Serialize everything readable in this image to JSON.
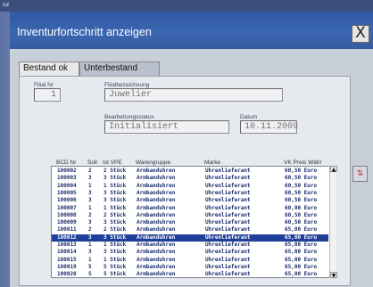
{
  "topbar": {
    "label": "sz"
  },
  "window": {
    "title": "Inventurfortschritt anzeigen",
    "close_icon_label": "X"
  },
  "tabs": [
    {
      "label": "Bestand ok",
      "active": true
    },
    {
      "label": "Unterbestand",
      "active": false
    }
  ],
  "form": {
    "filial_nr_label": "Filial Nr",
    "filial_nr_value": "1",
    "filial_bez_label": "Filialbezeichnung",
    "filial_bez_value": "Juwelier",
    "status_label": "Bearbeitungsstatus",
    "status_value": "Initialisiert",
    "datum_label": "Datum",
    "datum_value": "10.11.2009"
  },
  "table": {
    "columns": [
      "BCD Nr",
      "Soll",
      "Ist VPE",
      "Warengruppe",
      "Marke",
      "VK Preis Währ"
    ],
    "rows": [
      [
        "100002",
        "2",
        "2 Stück",
        "Armbanduhren",
        "Uhrenlieferant",
        "60,50 Euro"
      ],
      [
        "100003",
        "3",
        "3 Stück",
        "Armbanduhren",
        "Uhrenlieferant",
        "60,50 Euro"
      ],
      [
        "100004",
        "1",
        "1 Stück",
        "Armbanduhren",
        "Uhrenlieferant",
        "60,50 Euro"
      ],
      [
        "100005",
        "3",
        "3 Stück",
        "Armbanduhren",
        "Uhrenlieferant",
        "60,50 Euro"
      ],
      [
        "100006",
        "3",
        "3 Stück",
        "Armbanduhren",
        "Uhrenlieferant",
        "60,50 Euro"
      ],
      [
        "100007",
        "1",
        "1 Stück",
        "Armbanduhren",
        "Uhrenlieferant",
        "60,00 Euro"
      ],
      [
        "100008",
        "2",
        "2 Stück",
        "Armbanduhren",
        "Uhrenlieferant",
        "60,50 Euro"
      ],
      [
        "100009",
        "3",
        "3 Stück",
        "Armbanduhren",
        "Uhrenlieferant",
        "60,50 Euro"
      ],
      [
        "100011",
        "2",
        "2 Stück",
        "Armbanduhren",
        "Uhrenlieferant",
        "65,00 Euro"
      ],
      [
        "100012",
        "3",
        "3 Stück",
        "Armbanduhren",
        "Uhrenlieferant",
        "65,00 Euro"
      ],
      [
        "100013",
        "1",
        "1 Stück",
        "Armbanduhren",
        "Uhrenlieferant",
        "65,00 Euro"
      ],
      [
        "100014",
        "3",
        "3 Stück",
        "Armbanduhren",
        "Uhrenlieferant",
        "65,00 Euro"
      ],
      [
        "100015",
        "1",
        "1 Stück",
        "Armbanduhren",
        "Uhrenlieferant",
        "65,00 Euro"
      ],
      [
        "100019",
        "5",
        "5 Stück",
        "Armbanduhren",
        "Uhrenlieferant",
        "65,00 Euro"
      ],
      [
        "100020",
        "5",
        "5 Stück",
        "Armbanduhren",
        "Uhrenlieferant",
        "65,00 Euro"
      ]
    ],
    "selected_index": 9
  },
  "scrollbar": {
    "up_glyph": "▲",
    "down_glyph": "▼"
  },
  "sort_button": {
    "glyph": "⇅"
  },
  "colors": {
    "title_bar": "#2f5aa3",
    "selection": "#1f3f9a",
    "row_text": "#1a2d6a"
  }
}
